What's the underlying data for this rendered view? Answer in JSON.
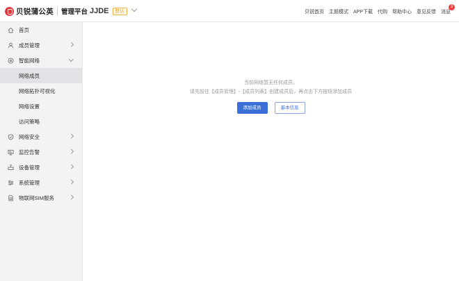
{
  "brand": {
    "name": "贝锐蒲公英",
    "platform": "管理平台",
    "accent": "#e4393c"
  },
  "org": {
    "name": "JJDE",
    "badge": "默认"
  },
  "topnav": {
    "items": [
      "贝锐首页",
      "主题模式",
      "APP下载",
      "代购",
      "帮助中心",
      "意见反馈"
    ],
    "messages_label": "消息",
    "messages_count": "3"
  },
  "sidebar": {
    "items": [
      {
        "label": "首页",
        "icon": "home-icon"
      },
      {
        "label": "成员管理",
        "icon": "user-icon"
      },
      {
        "label": "智能网络",
        "icon": "network-icon"
      },
      {
        "label": "网络成员"
      },
      {
        "label": "网络拓扑可视化"
      },
      {
        "label": "网络设置"
      },
      {
        "label": "访问策略"
      },
      {
        "label": "网络安全",
        "icon": "shield-icon"
      },
      {
        "label": "监控告警",
        "icon": "monitor-icon"
      },
      {
        "label": "设备管理",
        "icon": "device-icon"
      },
      {
        "label": "系统管理",
        "icon": "settings-icon"
      },
      {
        "label": "物联网SIM服务",
        "icon": "sim-icon"
      }
    ]
  },
  "main": {
    "empty_title": "当前网络暂无任何成员。",
    "empty_hint": "请先前往【成员管理】-【成员列表】创建成员后，再点击下方按钮添加成员",
    "primary_button": "添加成员",
    "secondary_button": "基本信息"
  },
  "colors": {
    "primary": "#3a6fd8",
    "badge": "#f03e3e"
  }
}
